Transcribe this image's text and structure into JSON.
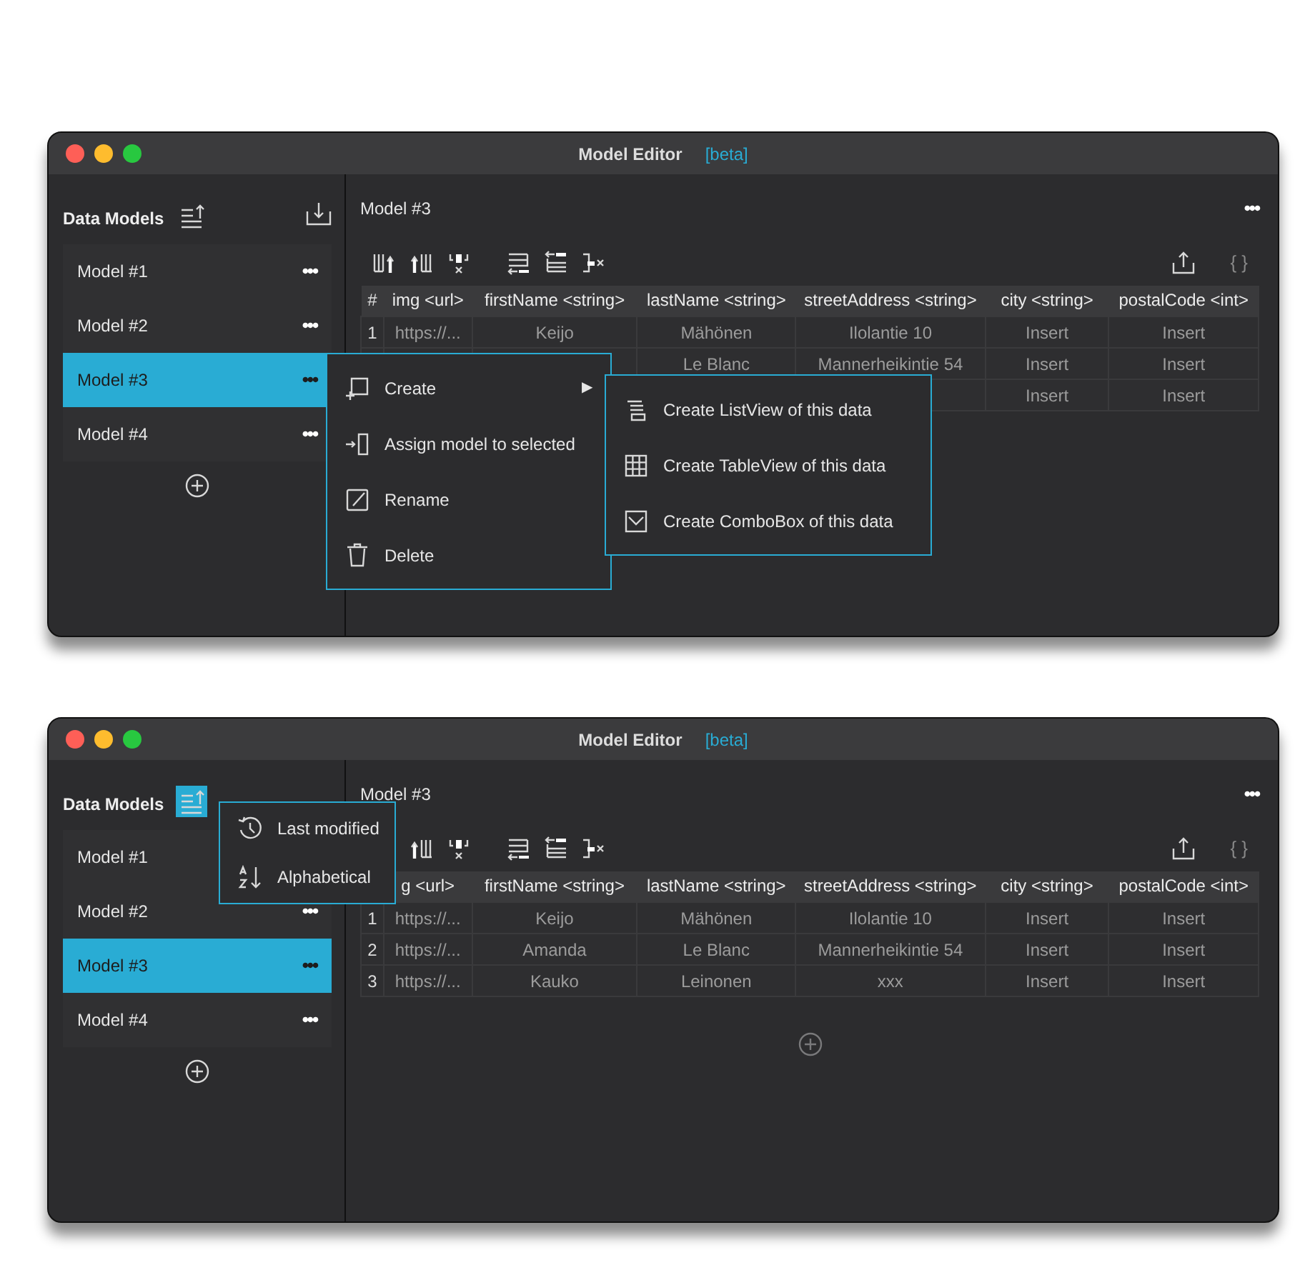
{
  "windows": [
    {
      "title": "Model Editor",
      "badge": "[beta]",
      "sidebar": {
        "heading": "Data Models",
        "sort_selected": false,
        "models": [
          {
            "label": "Model #1",
            "more": "•••",
            "selected": false
          },
          {
            "label": "Model #2",
            "more": "•••",
            "selected": false
          },
          {
            "label": "Model #3",
            "more": "•••",
            "selected": true
          },
          {
            "label": "Model #4",
            "more": "•••",
            "selected": false
          }
        ]
      },
      "main": {
        "title": "Model #3",
        "more": "•••",
        "code_button": "{ }",
        "table": {
          "columns": [
            "#",
            "img <url>",
            "firstName <string>",
            "lastName <string>",
            "streetAddress <string>",
            "city <string>",
            "postalCode <int>"
          ],
          "rows": [
            [
              "1",
              "https://...",
              "Keijo",
              "Mähönen",
              "Ilolantie 10",
              "Insert",
              "Insert"
            ],
            [
              null,
              null,
              null,
              "Le Blanc",
              "Mannerheikintie 54",
              "Insert",
              "Insert"
            ],
            [
              null,
              null,
              null,
              null,
              null,
              "Insert",
              "Insert"
            ]
          ]
        }
      },
      "context_menu": {
        "items": [
          {
            "kind": "create",
            "label": "Create",
            "arrow": "▶"
          },
          {
            "kind": "assign",
            "label": "Assign model to selected"
          },
          {
            "kind": "rename",
            "label": "Rename"
          },
          {
            "kind": "delete",
            "label": "Delete"
          }
        ],
        "submenu": [
          {
            "kind": "list",
            "label": "Create ListView of this data"
          },
          {
            "kind": "table",
            "label": "Create TableView of this data"
          },
          {
            "kind": "combo",
            "label": "Create ComboBox of this data"
          }
        ]
      }
    },
    {
      "title": "Model Editor",
      "badge": "[beta]",
      "sidebar": {
        "heading": "Data Models",
        "sort_selected": true,
        "models": [
          {
            "label": "Model #1",
            "selected": false
          },
          {
            "label": "Model #2",
            "more": "•••",
            "selected": false
          },
          {
            "label": "Model #3",
            "more": "•••",
            "selected": true
          },
          {
            "label": "Model #4",
            "more": "•••",
            "selected": false
          }
        ]
      },
      "main": {
        "title": "Model #3",
        "more": "•••",
        "code_button": "{ }",
        "add_row": true,
        "table": {
          "columns": [
            null,
            "g <url>",
            "firstName <string>",
            "lastName <string>",
            "streetAddress <string>",
            "city <string>",
            "postalCode <int>"
          ],
          "rows": [
            [
              "1",
              "https://...",
              "Keijo",
              "Mähönen",
              "Ilolantie 10",
              "Insert",
              "Insert"
            ],
            [
              "2",
              "https://...",
              "Amanda",
              "Le Blanc",
              "Mannerheikintie 54",
              "Insert",
              "Insert"
            ],
            [
              "3",
              "https://...",
              "Kauko",
              "Leinonen",
              "xxx",
              "Insert",
              "Insert"
            ]
          ]
        }
      },
      "sort_menu": [
        {
          "kind": "recent",
          "label": "Last modified"
        },
        {
          "kind": "alpha",
          "label": "Alphabetical"
        }
      ]
    }
  ]
}
